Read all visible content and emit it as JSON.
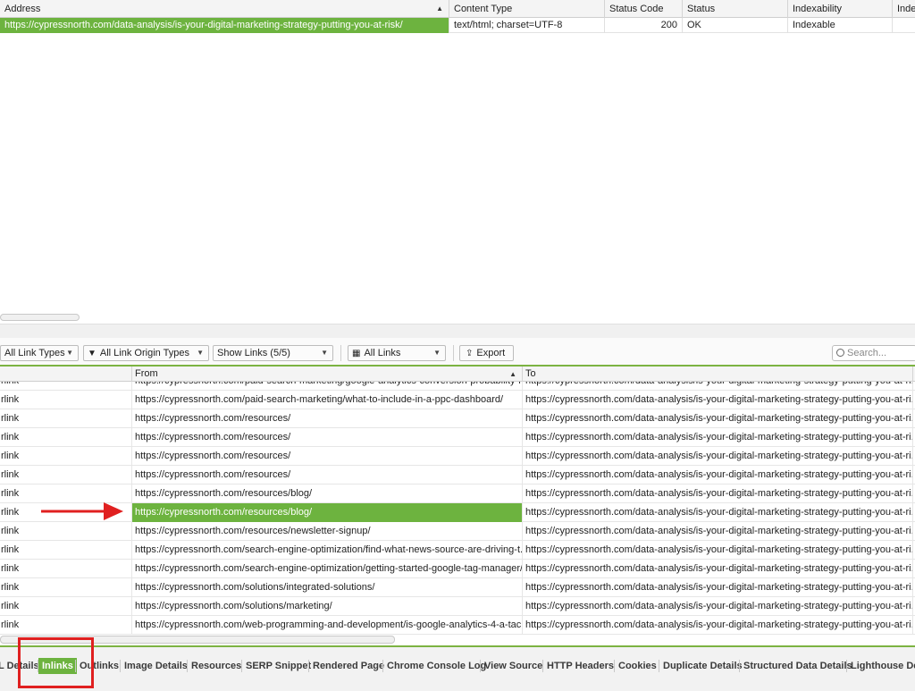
{
  "top_table": {
    "columns": [
      "Address",
      "Content Type",
      "Status Code",
      "Status",
      "Indexability",
      "Indexa"
    ],
    "row": {
      "address": "https://cypressnorth.com/data-analysis/is-your-digital-marketing-strategy-putting-you-at-risk/",
      "content_type": "text/html; charset=UTF-8",
      "status_code": "200",
      "status": "OK",
      "indexability": "Indexable"
    }
  },
  "toolbar": {
    "link_types": "All Link Types",
    "link_origin": "All Link Origin Types",
    "show_links": "Show Links (5/5)",
    "all_links": "All Links",
    "export": "Export",
    "search_placeholder": "Search..."
  },
  "links_table": {
    "columns": {
      "from": "From",
      "to": "To"
    },
    "partial_row": {
      "type": "rlink",
      "from": "https://cypressnorth.com/paid-search-marketing/google-analytics-conversion-probability-r...",
      "to": "https://cypressnorth.com/data-analysis/is-your-digital-marketing-strategy-putting-you-at-ri..."
    },
    "rows": [
      {
        "type": "rlink",
        "from": "https://cypressnorth.com/paid-search-marketing/what-to-include-in-a-ppc-dashboard/",
        "to": "https://cypressnorth.com/data-analysis/is-your-digital-marketing-strategy-putting-you-at-ri..."
      },
      {
        "type": "rlink",
        "from": "https://cypressnorth.com/resources/",
        "to": "https://cypressnorth.com/data-analysis/is-your-digital-marketing-strategy-putting-you-at-ri..."
      },
      {
        "type": "rlink",
        "from": "https://cypressnorth.com/resources/",
        "to": "https://cypressnorth.com/data-analysis/is-your-digital-marketing-strategy-putting-you-at-ri..."
      },
      {
        "type": "rlink",
        "from": "https://cypressnorth.com/resources/",
        "to": "https://cypressnorth.com/data-analysis/is-your-digital-marketing-strategy-putting-you-at-ri..."
      },
      {
        "type": "rlink",
        "from": "https://cypressnorth.com/resources/",
        "to": "https://cypressnorth.com/data-analysis/is-your-digital-marketing-strategy-putting-you-at-ri..."
      },
      {
        "type": "rlink",
        "from": "https://cypressnorth.com/resources/blog/",
        "to": "https://cypressnorth.com/data-analysis/is-your-digital-marketing-strategy-putting-you-at-ri..."
      },
      {
        "type": "rlink",
        "from": "https://cypressnorth.com/resources/blog/",
        "to": "https://cypressnorth.com/data-analysis/is-your-digital-marketing-strategy-putting-you-at-ri...",
        "selected": true
      },
      {
        "type": "rlink",
        "from": "https://cypressnorth.com/resources/newsletter-signup/",
        "to": "https://cypressnorth.com/data-analysis/is-your-digital-marketing-strategy-putting-you-at-ri..."
      },
      {
        "type": "rlink",
        "from": "https://cypressnorth.com/search-engine-optimization/find-what-news-source-are-driving-t...",
        "to": "https://cypressnorth.com/data-analysis/is-your-digital-marketing-strategy-putting-you-at-ri..."
      },
      {
        "type": "rlink",
        "from": "https://cypressnorth.com/search-engine-optimization/getting-started-google-tag-manager/",
        "to": "https://cypressnorth.com/data-analysis/is-your-digital-marketing-strategy-putting-you-at-ri..."
      },
      {
        "type": "rlink",
        "from": "https://cypressnorth.com/solutions/integrated-solutions/",
        "to": "https://cypressnorth.com/data-analysis/is-your-digital-marketing-strategy-putting-you-at-ri..."
      },
      {
        "type": "rlink",
        "from": "https://cypressnorth.com/solutions/marketing/",
        "to": "https://cypressnorth.com/data-analysis/is-your-digital-marketing-strategy-putting-you-at-ri..."
      },
      {
        "type": "rlink",
        "from": "https://cypressnorth.com/web-programming-and-development/is-google-analytics-4-a-tac...",
        "to": "https://cypressnorth.com/data-analysis/is-your-digital-marketing-strategy-putting-you-at-ri..."
      }
    ]
  },
  "tabs": [
    {
      "label": "L Details"
    },
    {
      "label": "Inlinks",
      "active": true
    },
    {
      "label": "Outlinks"
    },
    {
      "label": "Image Details"
    },
    {
      "label": "Resources"
    },
    {
      "label": "SERP Snippet"
    },
    {
      "label": "Rendered Page"
    },
    {
      "label": "Chrome Console Log"
    },
    {
      "label": "View Source"
    },
    {
      "label": "HTTP Headers"
    },
    {
      "label": "Cookies"
    },
    {
      "label": "Duplicate Details"
    },
    {
      "label": "Structured Data Details"
    },
    {
      "label": "Lighthouse Det"
    }
  ],
  "colors": {
    "accent_green": "#6db33f",
    "annotation_red": "#e02020"
  }
}
